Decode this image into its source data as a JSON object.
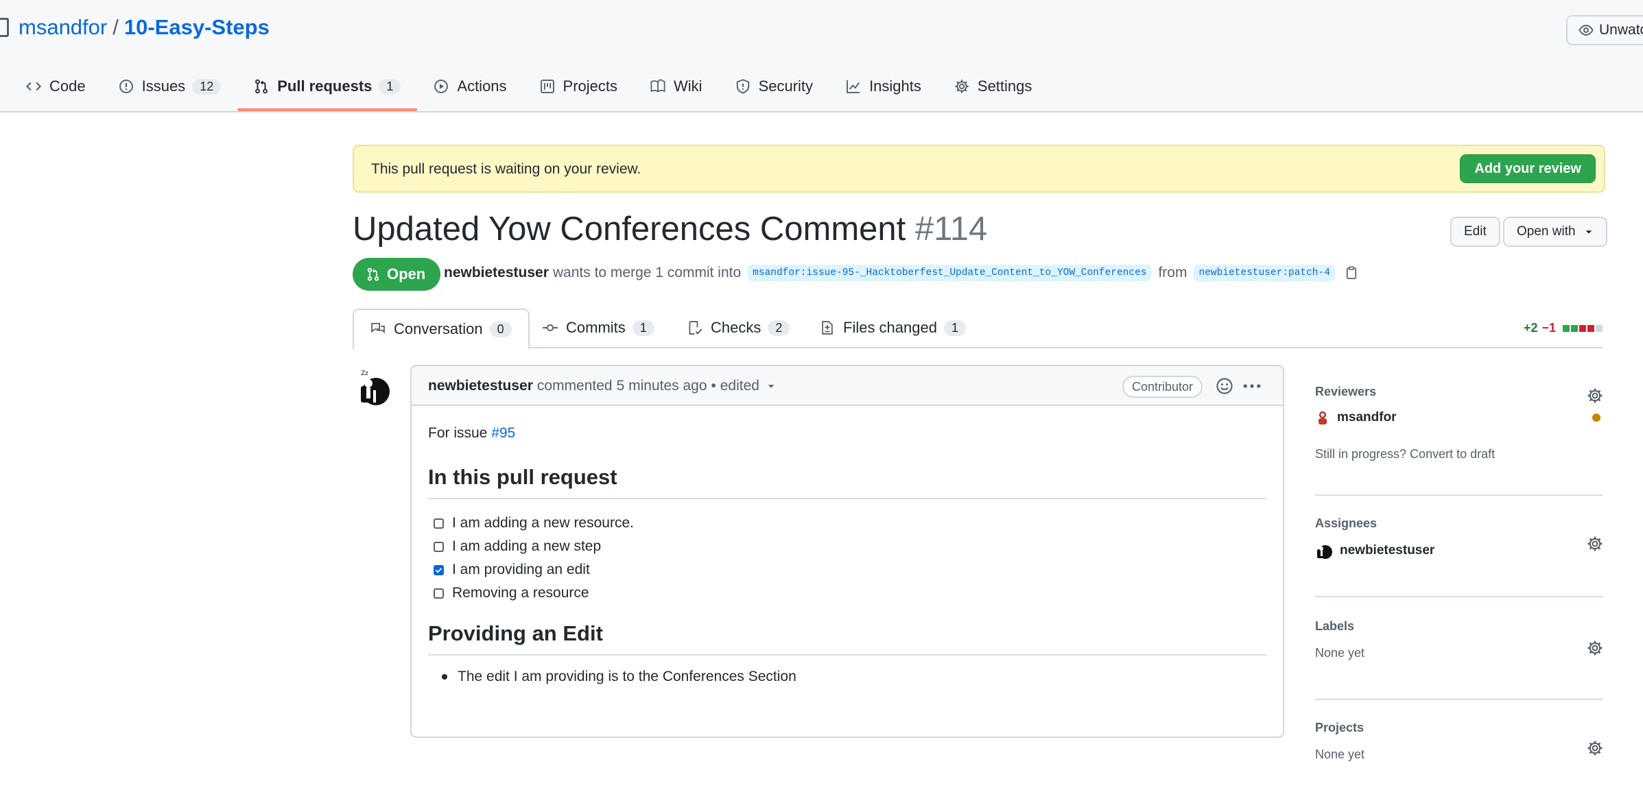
{
  "repo": {
    "owner": "msandfor",
    "separator": "/",
    "name": "10-Easy-Steps"
  },
  "unwatch_label": "Unwatch",
  "nav": [
    {
      "label": "Code",
      "icon": "code-icon"
    },
    {
      "label": "Issues",
      "icon": "issue-icon",
      "count": "12"
    },
    {
      "label": "Pull requests",
      "icon": "pull-request-icon",
      "count": "1",
      "selected": true
    },
    {
      "label": "Actions",
      "icon": "play-icon"
    },
    {
      "label": "Projects",
      "icon": "project-icon"
    },
    {
      "label": "Wiki",
      "icon": "book-icon"
    },
    {
      "label": "Security",
      "icon": "shield-icon"
    },
    {
      "label": "Insights",
      "icon": "graph-icon"
    },
    {
      "label": "Settings",
      "icon": "gear-icon"
    }
  ],
  "banner": {
    "text": "This pull request is waiting on your review.",
    "button": "Add your review"
  },
  "pr": {
    "title": "Updated Yow Conferences Comment",
    "number": "#114",
    "edit": "Edit",
    "open_with": "Open with",
    "state": "Open",
    "author": "newbietestuser",
    "merge_text": "wants to merge 1 commit into",
    "base_branch": "msandfor:issue-95-_Hacktoberfest_Update_Content_to_YOW_Conferences",
    "from_word": "from",
    "head_branch": "newbietestuser:patch-4"
  },
  "tabs": [
    {
      "label": "Conversation",
      "count": "0"
    },
    {
      "label": "Commits",
      "count": "1"
    },
    {
      "label": "Checks",
      "count": "2"
    },
    {
      "label": "Files changed",
      "count": "1"
    }
  ],
  "diffstat": {
    "additions": "+2",
    "deletions": "−1",
    "blocks": [
      "#2da44e",
      "#2da44e",
      "#cf222e",
      "#cf222e",
      "#d0d7de"
    ]
  },
  "comment": {
    "author": "newbietestuser",
    "action": "commented",
    "time": "5 minutes ago",
    "edited": "• edited",
    "role": "Contributor",
    "issue_prefix": "For issue",
    "issue_link": "#95",
    "heading1": "In this pull request",
    "tasks": [
      {
        "label": "I am adding a new resource.",
        "checked": false
      },
      {
        "label": "I am adding a new step",
        "checked": false
      },
      {
        "label": "I am providing an edit",
        "checked": true
      },
      {
        "label": "Removing a resource",
        "checked": false
      }
    ],
    "heading2": "Providing an Edit",
    "bullet1": "The edit I am providing is to the Conferences Section"
  },
  "sidebar": {
    "reviewers_title": "Reviewers",
    "reviewer": "msandfor",
    "draft_text": "Still in progress? Convert to draft",
    "assignees_title": "Assignees",
    "assignee": "newbietestuser",
    "labels_title": "Labels",
    "labels_value": "None yet",
    "projects_title": "Projects",
    "projects_value": "None yet"
  }
}
